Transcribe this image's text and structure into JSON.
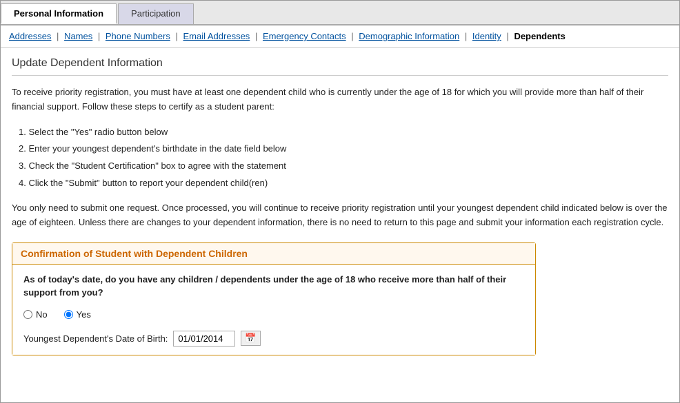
{
  "tabs": [
    {
      "label": "Personal Information",
      "active": true
    },
    {
      "label": "Participation",
      "active": false
    }
  ],
  "nav_links": [
    {
      "label": "Addresses",
      "active": false
    },
    {
      "label": "Names",
      "active": false
    },
    {
      "label": "Phone Numbers",
      "active": false
    },
    {
      "label": "Email Addresses",
      "active": false
    },
    {
      "label": "Emergency Contacts",
      "active": false
    },
    {
      "label": "Demographic Information",
      "active": false
    },
    {
      "label": "Identity",
      "active": false
    },
    {
      "label": "Dependents",
      "active": true
    }
  ],
  "page": {
    "title": "Update Dependent Information",
    "description": "To receive priority registration, you must have at least one dependent child who is currently under the age of 18 for which you will provide more than half of their financial support. Follow these steps to certify as a student parent:",
    "steps": [
      "1. Select the \"Yes\" radio button below",
      "2. Enter your youngest dependent's birthdate in the date field below",
      "3. Check the \"Student Certification\" box to agree with the statement",
      "4. Click the \"Submit\" button to report your dependent child(ren)"
    ],
    "note": "You only need to submit one request. Once processed, you will continue to receive priority registration until your youngest dependent child indicated below is over the age of eighteen. Unless there are changes to your dependent information, there is no need to return to this page and submit your information each registration cycle."
  },
  "confirmation": {
    "header": "Confirmation of Student with Dependent Children",
    "question": "As of today's date, do you have any children / dependents under the age of 18 who receive more than half of their support from you?",
    "radio_no_label": "No",
    "radio_yes_label": "Yes",
    "selected": "yes",
    "dob_label": "Youngest Dependent's Date of Birth:",
    "dob_value": "01/01/2014",
    "calendar_icon": "📅"
  }
}
